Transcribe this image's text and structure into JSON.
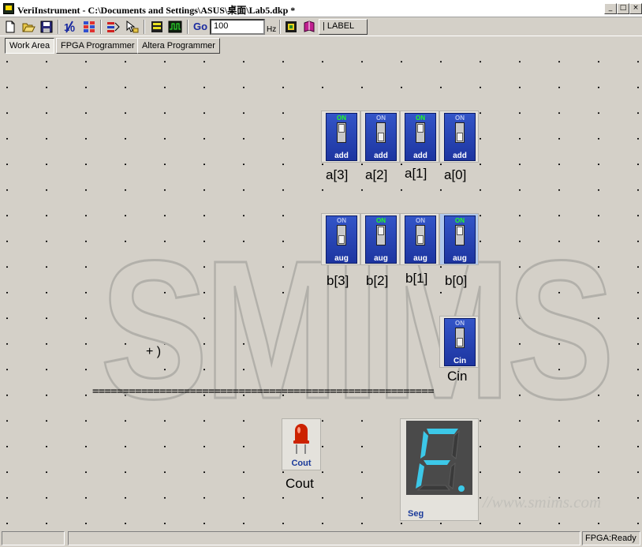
{
  "window": {
    "title": "VeriInstrument - C:\\Documents and Settings\\ASUS\\桌面\\Lab5.dkp *",
    "controls": [
      "minimize",
      "maximize",
      "close"
    ]
  },
  "toolbar": {
    "go_label": "Go",
    "frequency_value": "100",
    "frequency_unit": "Hz",
    "label_tool": "LABEL",
    "icons": [
      "new-file-icon",
      "open-folder-icon",
      "save-disk-icon",
      "binary-io-icon",
      "dip-switch-icon",
      "logic-tool-icon",
      "pointer-tool-icon",
      "memory-icon",
      "waveform-icon",
      "go-icon",
      "chip-icon",
      "book-icon"
    ]
  },
  "tabs": [
    {
      "label": "Work Area",
      "active": true
    },
    {
      "label": "FPGA Programmer",
      "active": false
    },
    {
      "label": "Altera Programmer",
      "active": false
    }
  ],
  "workspace": {
    "watermark": "SMIMS",
    "url_watermark": "//www.smims.com",
    "stray_text": "+ )",
    "separator": "========================================================",
    "switches_a": [
      {
        "tag": "add",
        "on_label": "ON",
        "signal": "a[3]",
        "lit": true
      },
      {
        "tag": "add",
        "on_label": "ON",
        "signal": "a[2]",
        "lit": false
      },
      {
        "tag": "add",
        "on_label": "ON",
        "signal": "a[1]",
        "lit": true
      },
      {
        "tag": "add",
        "on_label": "ON",
        "signal": "a[0]",
        "lit": false
      }
    ],
    "switches_b": [
      {
        "tag": "aug",
        "on_label": "ON",
        "signal": "b[3]",
        "lit": false
      },
      {
        "tag": "aug",
        "on_label": "ON",
        "signal": "b[2]",
        "lit": true
      },
      {
        "tag": "aug",
        "on_label": "ON",
        "signal": "b[1]",
        "lit": false
      },
      {
        "tag": "aug",
        "on_label": "ON",
        "signal": "b[0]",
        "lit": true
      }
    ],
    "switch_cin": {
      "tag": "Cin",
      "on_label": "ON",
      "signal": "Cin",
      "lit": false
    },
    "led": {
      "tag": "Cout",
      "signal": "Cout",
      "color": "#cc2200"
    },
    "seven_segment": {
      "tag": "Seg",
      "color": "#3cc8e8",
      "digit": "F"
    }
  },
  "status": {
    "cells": [
      "",
      "",
      "FPGA:Ready"
    ]
  }
}
